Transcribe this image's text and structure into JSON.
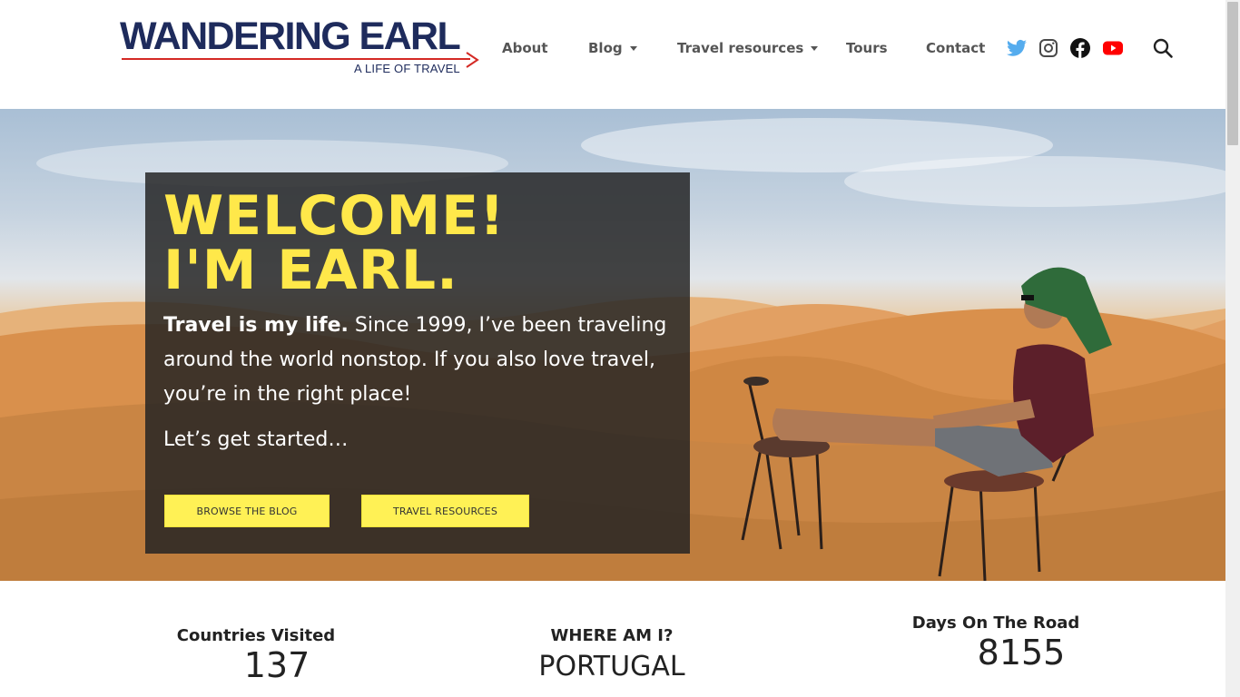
{
  "brand": {
    "name": "WANDERING EARL",
    "tagline": "A LIFE OF TRAVEL",
    "colors": {
      "navy": "#1e2b5c",
      "red": "#d42a25"
    }
  },
  "nav": {
    "items": [
      {
        "label": "About",
        "has_dropdown": false
      },
      {
        "label": "Blog",
        "has_dropdown": true
      },
      {
        "label": "Travel resources",
        "has_dropdown": true
      },
      {
        "label": "Tours",
        "has_dropdown": false
      },
      {
        "label": "Contact",
        "has_dropdown": false
      }
    ],
    "social": [
      {
        "icon": "twitter-icon",
        "color": "#55acee"
      },
      {
        "icon": "instagram-icon",
        "color": "#4a4a4a"
      },
      {
        "icon": "facebook-icon",
        "color": "#111111"
      },
      {
        "icon": "youtube-icon",
        "color": "#ff0000"
      }
    ],
    "search_icon": "search-icon"
  },
  "hero": {
    "title_line1": "WELCOME!",
    "title_line2": "I'M EARL.",
    "intro_bold": "Travel is my life.",
    "intro_rest": " Since 1999, I’ve been traveling around the world nonstop. If you also love travel, you’re in the right place!",
    "cta_text": "Let’s get started…",
    "buttons": [
      {
        "label": "BROWSE THE BLOG"
      },
      {
        "label": "TRAVEL RESOURCES"
      }
    ],
    "title_color": "#ffe84a",
    "button_color": "#fff155"
  },
  "stats": [
    {
      "label": "Countries Visited",
      "value": "137"
    },
    {
      "label": "WHERE AM I?",
      "value": "PORTUGAL"
    },
    {
      "label": "Days On The Road",
      "value": "8155"
    }
  ]
}
